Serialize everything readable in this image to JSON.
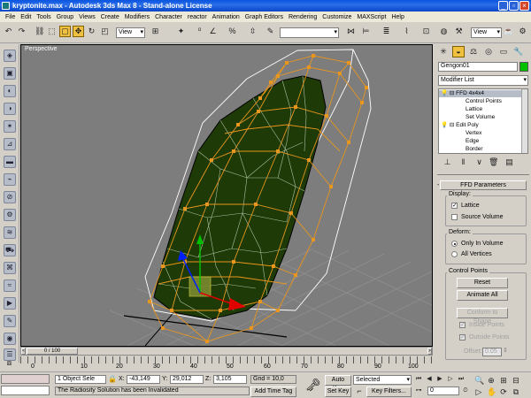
{
  "window": {
    "title": "kryptonite.max - Autodesk 3ds Max 8  - Stand-alone License"
  },
  "menu": [
    "File",
    "Edit",
    "Tools",
    "Group",
    "Views",
    "Create",
    "Modifiers",
    "Character",
    "reactor",
    "Animation",
    "Graph Editors",
    "Rendering",
    "Customize",
    "MAXScript",
    "Help"
  ],
  "toolbar": {
    "ref_coord": "View",
    "ref_coord_right": "View"
  },
  "viewport": {
    "label": "Perspective"
  },
  "command_panel": {
    "object_name": "Gengon01",
    "object_color": "#00c000",
    "modifier_list": "Modifier List",
    "stack": [
      {
        "label": "FFD 4x4x4",
        "level": 0,
        "selected": true
      },
      {
        "label": "Control Points",
        "level": 1
      },
      {
        "label": "Lattice",
        "level": 1
      },
      {
        "label": "Set Volume",
        "level": 1
      },
      {
        "label": "Edit Poly",
        "level": 0
      },
      {
        "label": "Vertex",
        "level": 1
      },
      {
        "label": "Edge",
        "level": 1
      },
      {
        "label": "Border",
        "level": 1
      }
    ],
    "rollout_title": "FFD Parameters",
    "display": {
      "title": "Display:",
      "lattice": "Lattice",
      "lattice_checked": true,
      "source_volume": "Source Volume",
      "source_volume_checked": false
    },
    "deform": {
      "title": "Deform:",
      "only_in_volume": "Only In Volume",
      "all_vertices": "All Vertices",
      "selected": "only_in_volume"
    },
    "control_points": {
      "title": "Control Points",
      "reset": "Reset",
      "animate_all": "Animate All",
      "conform_to_shape": "Conform to Shape",
      "inside_points": "Inside Points",
      "outside_points": "Outside Points",
      "offset_label": "Offset:",
      "offset_value": "0.05"
    }
  },
  "timeline": {
    "slider_label": "0 / 100",
    "ticks": [
      "0",
      "10",
      "20",
      "30",
      "40",
      "50",
      "60",
      "70",
      "80",
      "90",
      "100"
    ]
  },
  "status": {
    "selection": "1 Object Sele",
    "x": "-43,149",
    "y": "29,012",
    "z": "3,105",
    "grid": "Grid = 10,0",
    "message": "The Radiosity Solution has been Invalidated",
    "add_time_tag": "Add Time Tag",
    "auto_key": "Auto Key",
    "set_key": "Set Key",
    "key_mode": "Selected",
    "key_filters": "Key Filters...",
    "frame": "0"
  },
  "colors": {
    "accent": "#f0c040",
    "viewport_bg": "#7d7d7d",
    "lattice": "#e8961e",
    "mesh_fill": "#1e3a06"
  }
}
